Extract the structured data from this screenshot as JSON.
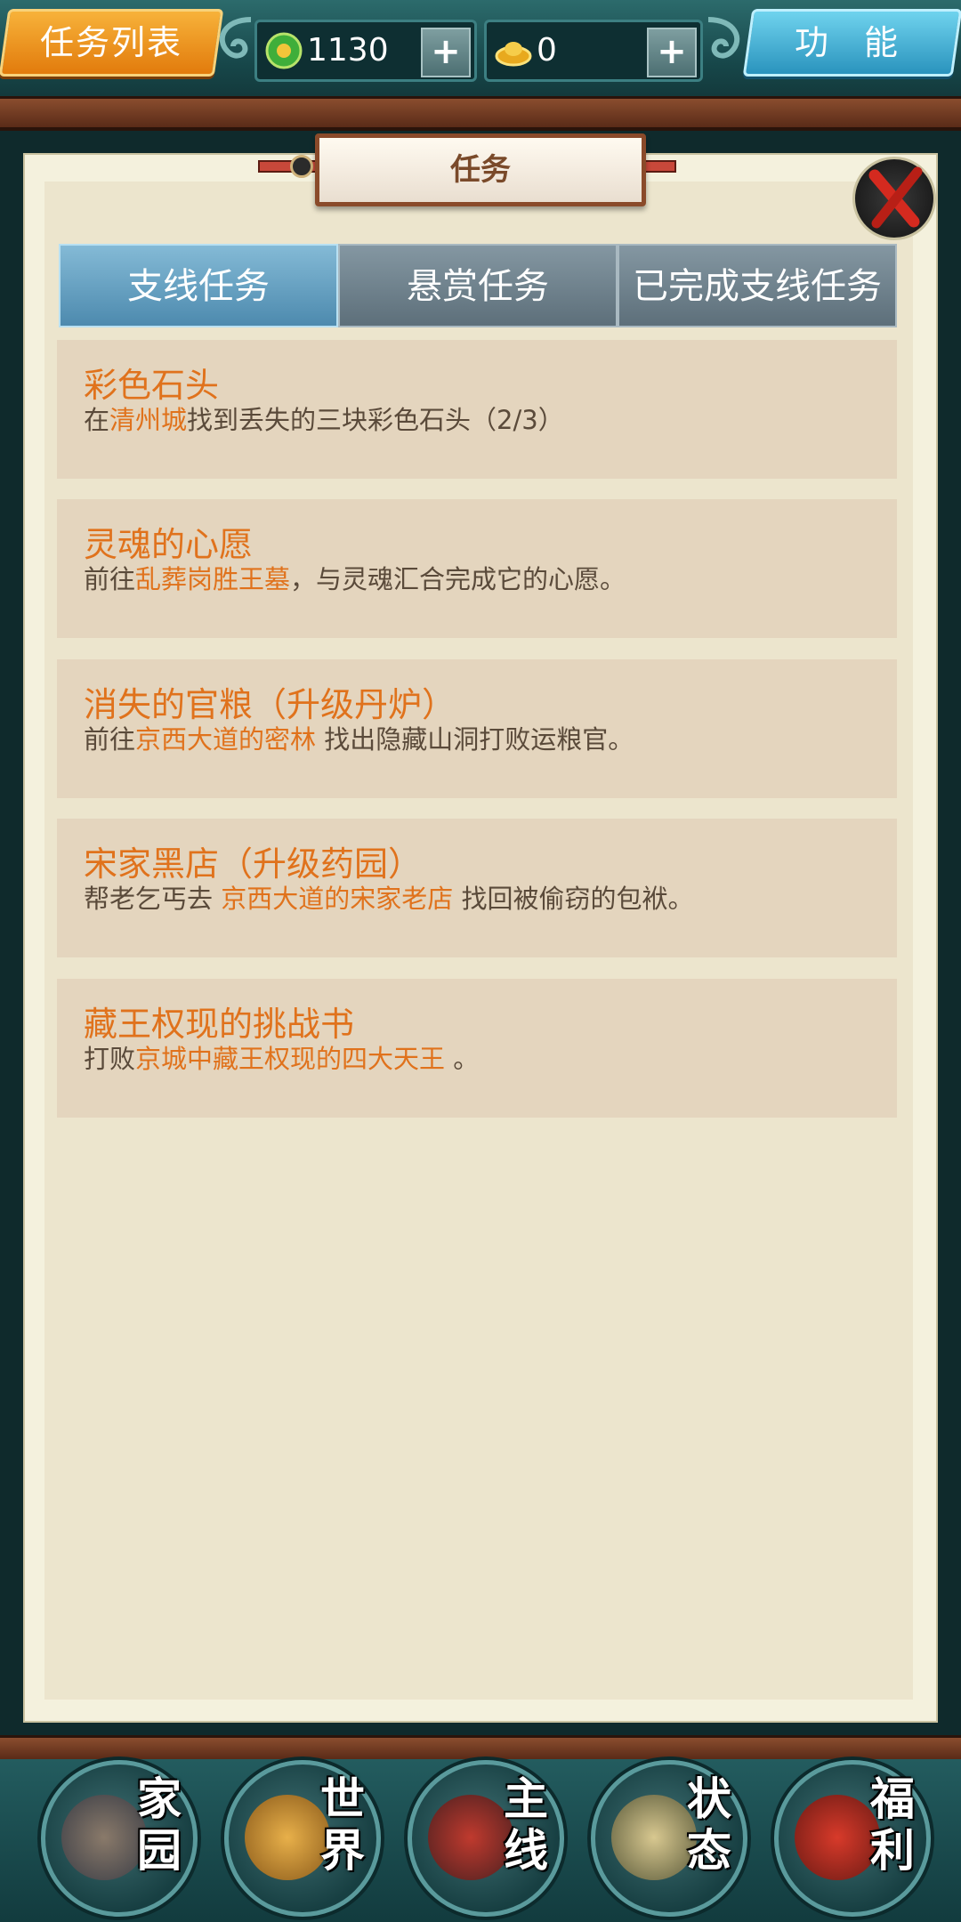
{
  "header": {
    "title": "任务列表",
    "currency": [
      {
        "icon": "jade-coin-icon",
        "value": "1130",
        "plus": "+"
      },
      {
        "icon": "gold-ingot-icon",
        "value": "0",
        "plus": "+"
      }
    ],
    "function_label": "功 能"
  },
  "panel": {
    "title": "任务",
    "tabs": [
      "支线任务",
      "悬赏任务",
      "已完成支线任务"
    ],
    "active_tab": "支线任务"
  },
  "quests": [
    {
      "title": "彩色石头",
      "d1": "在",
      "d2": "清州城",
      "d3": "找到丢失的三块彩色石头（2/3）"
    },
    {
      "title": "灵魂的心愿",
      "d1": "前往",
      "d2": "乱葬岗胜王墓",
      "d3": "，与灵魂汇合完成它的心愿。"
    },
    {
      "title": "消失的官粮（升级丹炉）",
      "d1": "前往",
      "d2": "京西大道的密林",
      "d3": " 找出隐藏山洞打败运粮官。"
    },
    {
      "title": "宋家黑店（升级药园）",
      "d1": "帮老乞丐去 ",
      "d2": "京西大道的宋家老店",
      "d3": " 找回被偷窃的包袱。"
    },
    {
      "title": "藏王权现的挑战书",
      "d1": "打败",
      "d2": "京城中藏王权现的四大天王",
      "d3": " 。"
    }
  ],
  "bottom_nav": [
    {
      "label": "家园",
      "icon": "home-icon"
    },
    {
      "label": "世界",
      "icon": "world-icon"
    },
    {
      "label": "主线",
      "icon": "main-quest-icon"
    },
    {
      "label": "状态",
      "icon": "status-icon"
    },
    {
      "label": "福利",
      "icon": "welfare-icon"
    }
  ],
  "colors": {
    "accent": "#e0721c",
    "tab_active": "#4d8aae",
    "panel_bg": "#ece5cd"
  }
}
